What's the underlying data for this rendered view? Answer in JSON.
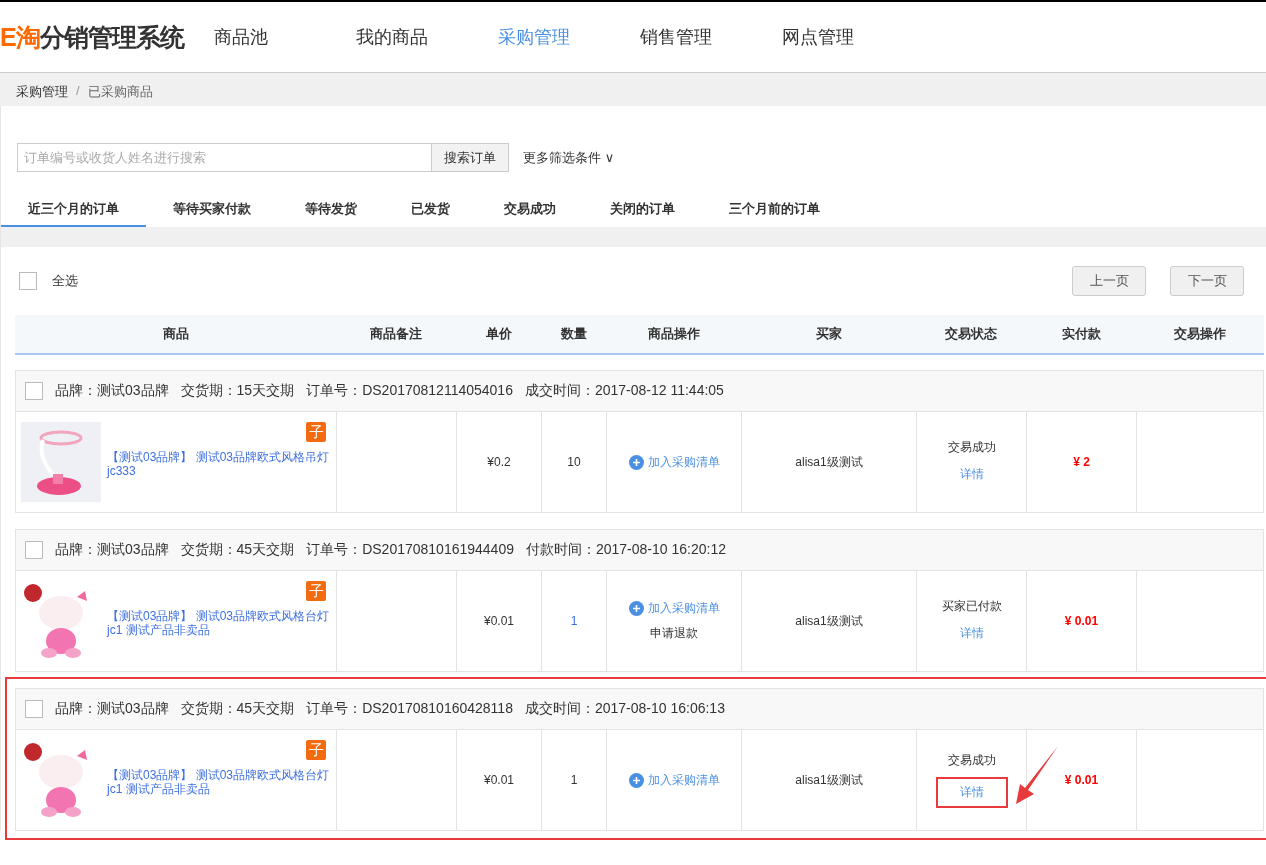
{
  "header": {
    "logo_accent": "E淘",
    "logo_text": "分销管理系统",
    "nav": [
      {
        "label": "商品池",
        "selected": false
      },
      {
        "label": "我的商品",
        "selected": false
      },
      {
        "label": "采购管理",
        "selected": true
      },
      {
        "label": "销售管理",
        "selected": false
      },
      {
        "label": "网点管理",
        "selected": false
      }
    ]
  },
  "breadcrumb": [
    "采购管理",
    "已采购商品"
  ],
  "breadcrumb_separator": "/",
  "search": {
    "placeholder": "订单编号或收货人姓名进行搜索",
    "button": "搜索订单",
    "filter": "更多筛选条件",
    "filter_caret": "∨"
  },
  "tabs": [
    {
      "label": "近三个月的订单",
      "selected": true
    },
    {
      "label": "等待买家付款",
      "selected": false
    },
    {
      "label": "等待发货",
      "selected": false
    },
    {
      "label": "已发货",
      "selected": false
    },
    {
      "label": "交易成功",
      "selected": false
    },
    {
      "label": "关闭的订单",
      "selected": false
    },
    {
      "label": "三个月前的订单",
      "selected": false
    }
  ],
  "select_all": {
    "label": "全选",
    "checked": false
  },
  "pager": [
    "上一页",
    "下一页"
  ],
  "table": {
    "columns": [
      "商品",
      "商品备注",
      "单价",
      "数量",
      "商品操作",
      "买家",
      "交易状态",
      "实付款",
      "交易操作"
    ]
  },
  "orders": [
    {
      "checked": false,
      "highlighted": false,
      "brand": "品牌：测试03品牌",
      "delivery": "交货期：15天交期",
      "order_no": "订单号：DS20170812114054016",
      "time": "成交时间：2017-08-12 11:44:05",
      "items": [
        {
          "image": {
            "kind": "picture"
          },
          "tag": "子",
          "title": "【测试03品牌】 测试03品牌欧式风格吊灯",
          "code": "jc333",
          "price": "¥0.2",
          "qty": "10",
          "qty_link": false,
          "actions": [
            {
              "kind": "add",
              "label": "加入采购清单"
            }
          ],
          "buyer": "alisa1级测试",
          "status": "交易成功",
          "detail": "详情",
          "detail_boxed": false,
          "paid": "¥ 2"
        }
      ]
    },
    {
      "checked": false,
      "highlighted": false,
      "brand": "品牌：测试03品牌",
      "delivery": "交货期：45天交期",
      "order_no": "订单号：DS20170810161944409",
      "time": "付款时间：2017-08-10 16:20:12",
      "items": [
        {
          "image": {
            "kind": "picture"
          },
          "tag": "子",
          "title": "【测试03品牌】 测试03品牌欧式风格台灯",
          "code": "jc1 测试产品非卖品",
          "price": "¥0.01",
          "qty": "1",
          "qty_link": true,
          "actions": [
            {
              "kind": "add",
              "label": "加入采购清单"
            },
            {
              "kind": "text",
              "label": "申请退款"
            }
          ],
          "buyer": "alisa1级测试",
          "status": "买家已付款",
          "detail": "详情",
          "detail_boxed": false,
          "paid": "¥ 0.01"
        }
      ]
    },
    {
      "checked": false,
      "highlighted": true,
      "brand": "品牌：测试03品牌",
      "delivery": "交货期：45天交期",
      "order_no": "订单号：DS20170810160428118",
      "time": "成交时间：2017-08-10 16:06:13",
      "items": [
        {
          "image": {
            "kind": "picture"
          },
          "tag": "子",
          "title": "【测试03品牌】 测试03品牌欧式风格台灯",
          "code": "jc1 测试产品非卖品",
          "price": "¥0.01",
          "qty": "1",
          "qty_link": false,
          "actions": [
            {
              "kind": "add",
              "label": "加入采购清单"
            }
          ],
          "buyer": "alisa1级测试",
          "status": "交易成功",
          "detail": "详情",
          "detail_boxed": true,
          "paid": "¥ 0.01"
        }
      ]
    }
  ]
}
